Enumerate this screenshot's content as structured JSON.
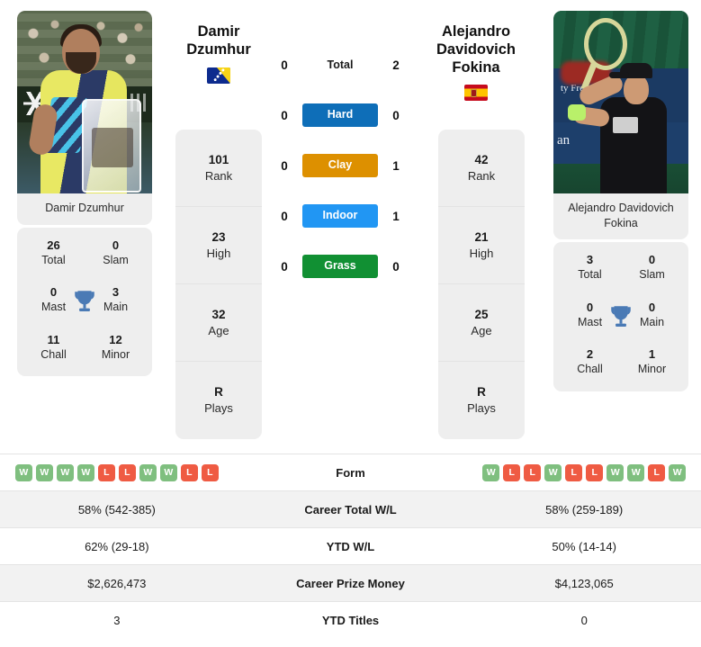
{
  "players": {
    "left": {
      "name_line1": "Damir",
      "name_line2": "Dzumhur",
      "full_name": "Damir Dzumhur",
      "flag": "bosnia-and-herzegovina-flag",
      "photo_alt": "Damir Dzumhur holding trophy",
      "stats": [
        {
          "value": "101",
          "label": "Rank"
        },
        {
          "value": "23",
          "label": "High"
        },
        {
          "value": "32",
          "label": "Age"
        },
        {
          "value": "R",
          "label": "Plays"
        }
      ],
      "titles": [
        {
          "value": "26",
          "label": "Total"
        },
        {
          "value": "0",
          "label": "Slam"
        },
        {
          "value": "0",
          "label": "Mast"
        },
        {
          "value": "3",
          "label": "Main"
        },
        {
          "value": "11",
          "label": "Chall"
        },
        {
          "value": "12",
          "label": "Minor"
        }
      ],
      "form": [
        "W",
        "W",
        "W",
        "W",
        "L",
        "L",
        "W",
        "W",
        "L",
        "L"
      ],
      "career_total_wl": "58% (542-385)",
      "ytd_wl": "62% (29-18)",
      "career_prize_money": "$2,626,473",
      "ytd_titles": "3"
    },
    "right": {
      "name_line1": "Alejandro",
      "name_line2": "Davidovich",
      "name_line3": "Fokina",
      "full_name": "Alejandro Davidovich Fokina",
      "flag": "spain-flag",
      "photo_alt": "Alejandro Davidovich Fokina hitting overhead",
      "stats": [
        {
          "value": "42",
          "label": "Rank"
        },
        {
          "value": "21",
          "label": "High"
        },
        {
          "value": "25",
          "label": "Age"
        },
        {
          "value": "R",
          "label": "Plays"
        }
      ],
      "titles": [
        {
          "value": "3",
          "label": "Total"
        },
        {
          "value": "0",
          "label": "Slam"
        },
        {
          "value": "0",
          "label": "Mast"
        },
        {
          "value": "0",
          "label": "Main"
        },
        {
          "value": "2",
          "label": "Chall"
        },
        {
          "value": "1",
          "label": "Minor"
        }
      ],
      "form": [
        "W",
        "L",
        "L",
        "W",
        "L",
        "L",
        "W",
        "W",
        "L",
        "W"
      ],
      "career_total_wl": "58% (259-189)",
      "ytd_wl": "50% (14-14)",
      "career_prize_money": "$4,123,065",
      "ytd_titles": "0"
    }
  },
  "head_to_head": [
    {
      "label": "Total",
      "left": "0",
      "right": "2",
      "style": "plain",
      "color": ""
    },
    {
      "label": "Hard",
      "left": "0",
      "right": "0",
      "style": "badge",
      "color": "#0e6eb8"
    },
    {
      "label": "Clay",
      "left": "0",
      "right": "1",
      "style": "badge",
      "color": "#dd9000"
    },
    {
      "label": "Indoor",
      "left": "0",
      "right": "1",
      "style": "badge",
      "color": "#2196f3"
    },
    {
      "label": "Grass",
      "left": "0",
      "right": "0",
      "style": "badge",
      "color": "#119033"
    }
  ],
  "comparison_rows": [
    {
      "label": "Form",
      "left": "",
      "right": "",
      "type": "form"
    },
    {
      "label": "Career Total W/L",
      "left": "58% (542-385)",
      "right": "58% (259-189)",
      "type": "text"
    },
    {
      "label": "YTD W/L",
      "left": "62% (29-18)",
      "right": "50% (14-14)",
      "type": "text"
    },
    {
      "label": "Career Prize Money",
      "left": "$2,626,473",
      "right": "$4,123,065",
      "type": "text"
    },
    {
      "label": "YTD Titles",
      "left": "3",
      "right": "0",
      "type": "text"
    }
  ],
  "colors": {
    "hard": "#0e6eb8",
    "clay": "#dd9000",
    "indoor": "#2196f3",
    "grass": "#119033",
    "win": "#7fbf7f",
    "loss": "#ef5b43",
    "card_bg": "#eeeeee",
    "row_shaded": "#f2f2f2",
    "trophy": "#4a7ab5"
  }
}
